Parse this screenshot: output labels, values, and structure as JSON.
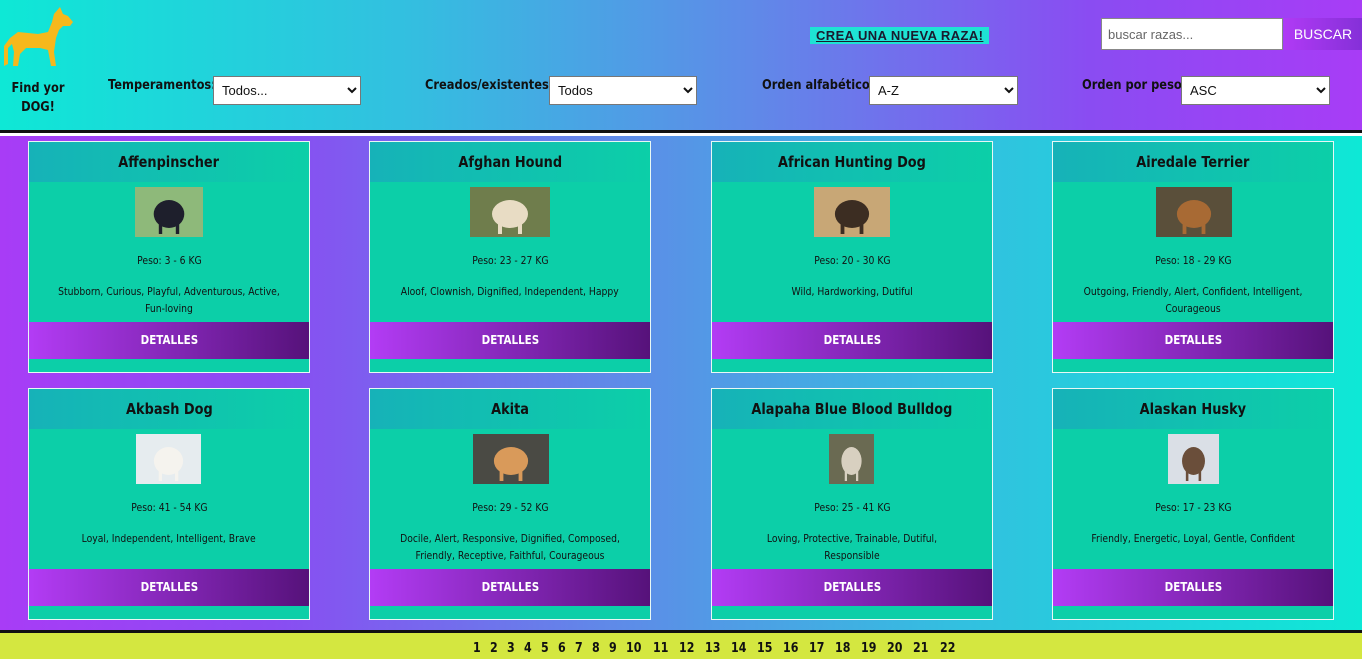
{
  "header": {
    "logo_text": "Find yor DOG!",
    "create_link": "CREA UNA NUEVA RAZA!",
    "search": {
      "placeholder": "buscar razas...",
      "button": "BUSCAR"
    },
    "filters": {
      "temperaments": {
        "label": "Temperamentos:",
        "selected": "Todos..."
      },
      "created": {
        "label": "Creados/existentes:",
        "selected": "Todos"
      },
      "alpha": {
        "label": "Orden alfabético:",
        "selected": "A-Z"
      },
      "weight": {
        "label": "Orden por peso:",
        "selected": "ASC"
      }
    },
    "colors": {
      "logo": "#f6b81c",
      "accent": "#1ee3d4"
    }
  },
  "cards": [
    {
      "name": "Affenpinscher",
      "weight": "Peso: 3 - 6 KG",
      "temperament": "Stubborn, Curious, Playful, Adventurous, Active, Fun-loving",
      "button": "DETALLES",
      "photo": {
        "bg": "#8eb97a",
        "dog": "#1e1f2c"
      }
    },
    {
      "name": "Afghan Hound",
      "weight": "Peso: 23 - 27 KG",
      "temperament": "Aloof, Clownish, Dignified, Independent, Happy",
      "button": "DETALLES",
      "photo": {
        "bg": "#6f7d4c",
        "dog": "#e8dcc4"
      }
    },
    {
      "name": "African Hunting Dog",
      "weight": "Peso: 20 - 30 KG",
      "temperament": "Wild, Hardworking, Dutiful",
      "button": "DETALLES",
      "photo": {
        "bg": "#c8a776",
        "dog": "#3c2d22"
      }
    },
    {
      "name": "Airedale Terrier",
      "weight": "Peso: 18 - 29 KG",
      "temperament": "Outgoing, Friendly, Alert, Confident, Intelligent, Courageous",
      "button": "DETALLES",
      "photo": {
        "bg": "#5a4f3a",
        "dog": "#a86a34"
      }
    },
    {
      "name": "Akbash Dog",
      "weight": "Peso: 41 - 54 KG",
      "temperament": "Loyal, Independent, Intelligent, Brave",
      "button": "DETALLES",
      "photo": {
        "bg": "#e6ecef",
        "dog": "#f5f3ee"
      }
    },
    {
      "name": "Akita",
      "weight": "Peso: 29 - 52 KG",
      "temperament": "Docile, Alert, Responsive, Dignified, Composed, Friendly, Receptive, Faithful, Courageous",
      "button": "DETALLES",
      "photo": {
        "bg": "#4a4a44",
        "dog": "#d99a5a"
      }
    },
    {
      "name": "Alapaha Blue Blood Bulldog",
      "weight": "Peso: 25 - 41 KG",
      "temperament": "Loving, Protective, Trainable, Dutiful, Responsible",
      "button": "DETALLES",
      "photo": {
        "bg": "#6a6a52",
        "dog": "#d8d0c0"
      }
    },
    {
      "name": "Alaskan Husky",
      "weight": "Peso: 17 - 23 KG",
      "temperament": "Friendly, Energetic, Loyal, Gentle, Confident",
      "button": "DETALLES",
      "photo": {
        "bg": "#dadfe6",
        "dog": "#6a4e3a"
      }
    }
  ],
  "pagination": [
    "1",
    "2",
    "3",
    "4",
    "5",
    "6",
    "7",
    "8",
    "9",
    "10",
    "11",
    "12",
    "13",
    "14",
    "15",
    "16",
    "17",
    "18",
    "19",
    "20",
    "21",
    "22"
  ]
}
